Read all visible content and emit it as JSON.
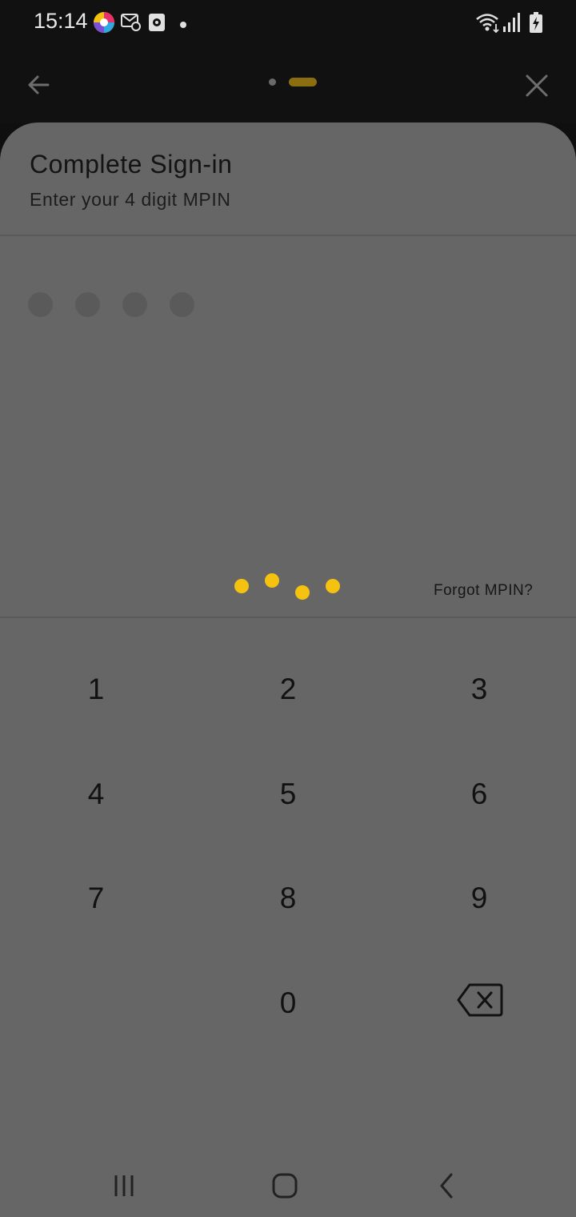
{
  "status_bar": {
    "time": "15:14",
    "icons": [
      "pinwheel-app-icon",
      "mail-settings-icon",
      "screen-recorder-icon",
      "notification-dot-icon",
      "wifi-icon",
      "signal-icon",
      "battery-charging-icon"
    ]
  },
  "nav": {
    "back_icon": "arrow-left-icon",
    "close_icon": "close-icon",
    "steps_total": 2,
    "current_step": 2
  },
  "signin": {
    "title": "Complete Sign-in",
    "subtitle": "Enter your 4 digit MPIN",
    "pin_length": 4,
    "pin_entered": 0,
    "forgot_label": "Forgot MPIN?"
  },
  "keypad": {
    "keys": [
      "1",
      "2",
      "3",
      "4",
      "5",
      "6",
      "7",
      "8",
      "9",
      "0"
    ],
    "backspace_icon": "backspace-icon"
  },
  "colors": {
    "accent": "#f5c20f",
    "sheet_bg": "#666666",
    "dark_bg": "#111111"
  }
}
